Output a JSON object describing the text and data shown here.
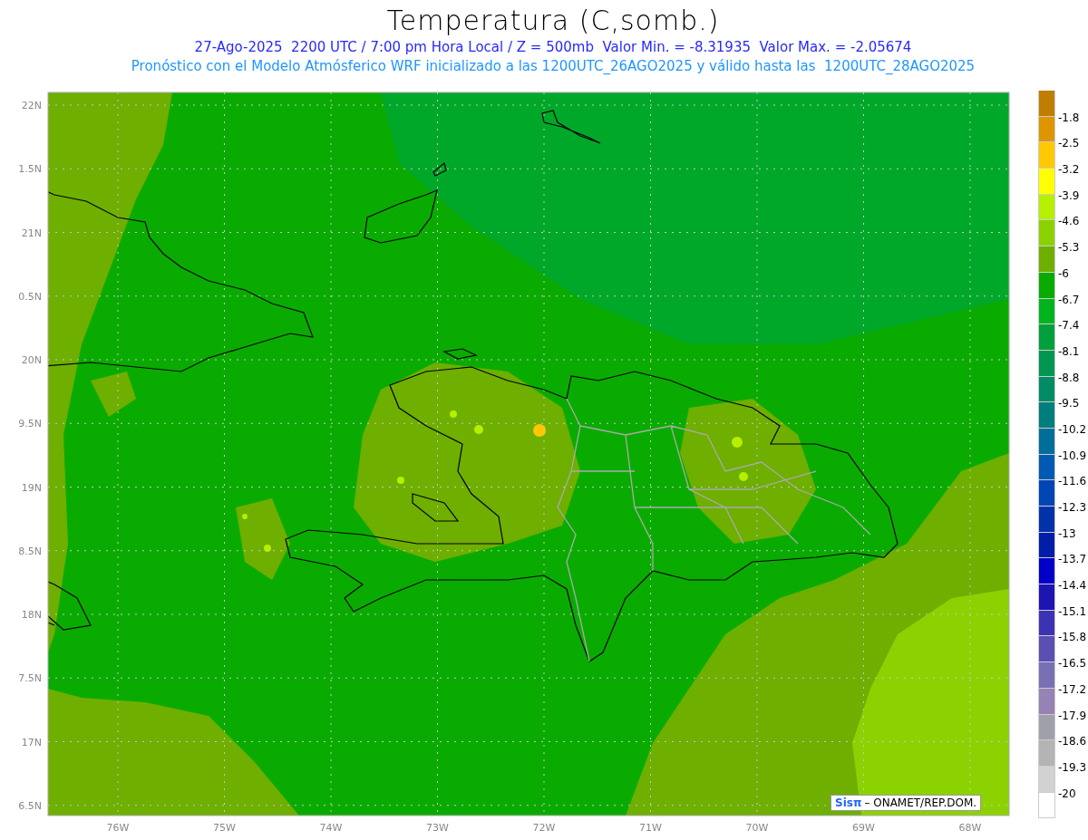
{
  "title": "Temperatura (C,somb.)",
  "subtitle_lines": [
    "27-Ago-2025  2200 UTC / 7:00 pm Hora Local / Z = 500mb  Valor Min. = -8.31935  Valor Max. = -2.05674",
    "Pronóstico con el Modelo Atmósferico WRF inicializado a las 1200UTC_26AGO2025 y válido hasta las  1200UTC_28AGO2025"
  ],
  "map": {
    "y_labels": [
      "22N",
      "1.5N",
      "21N",
      "0.5N",
      "20N",
      "9.5N",
      "19N",
      "8.5N",
      "18N",
      "7.5N",
      "17N",
      "6.5N"
    ],
    "x_labels": [
      "76W",
      "75W",
      "74W",
      "73W",
      "72W",
      "71W",
      "70W",
      "69W",
      "68W"
    ],
    "credit": {
      "logo": "Sisπ",
      "text": "– ONAMET/REP.DOM."
    }
  },
  "colorbar": {
    "segments": [
      {
        "color": "#c07d00",
        "label": "-1.8"
      },
      {
        "color": "#de9600",
        "label": "-2.5"
      },
      {
        "color": "#ffc800",
        "label": "-3.2"
      },
      {
        "color": "#ffff00",
        "label": "-3.9"
      },
      {
        "color": "#b4f000",
        "label": "-4.6"
      },
      {
        "color": "#8cd200",
        "label": "-5.3"
      },
      {
        "color": "#6eaf00",
        "label": "-6"
      },
      {
        "color": "#0aab00",
        "label": "-6.7"
      },
      {
        "color": "#00b41e",
        "label": "-7.4"
      },
      {
        "color": "#00a03c",
        "label": "-8.1"
      },
      {
        "color": "#009650",
        "label": "-8.8"
      },
      {
        "color": "#008c64",
        "label": "-9.5"
      },
      {
        "color": "#007d7d",
        "label": "-10.2"
      },
      {
        "color": "#006e9b",
        "label": "-10.9"
      },
      {
        "color": "#005ab4",
        "label": "-11.6"
      },
      {
        "color": "#0046b4",
        "label": "-12.3"
      },
      {
        "color": "#0032aa",
        "label": "-13"
      },
      {
        "color": "#001eaa",
        "label": "-13.7"
      },
      {
        "color": "#0000c8",
        "label": "-14.4"
      },
      {
        "color": "#1e14b4",
        "label": "-15.1"
      },
      {
        "color": "#3c32b4",
        "label": "-15.8"
      },
      {
        "color": "#5a50b4",
        "label": "-16.5"
      },
      {
        "color": "#7870b4",
        "label": "-17.2"
      },
      {
        "color": "#9682b4",
        "label": "-17.9"
      },
      {
        "color": "#a0a0aa",
        "label": "-18.6"
      },
      {
        "color": "#b4b4b4",
        "label": "-19.3"
      },
      {
        "color": "#d2d2d2",
        "label": "-20"
      },
      {
        "color": "#ffffff"
      }
    ]
  }
}
